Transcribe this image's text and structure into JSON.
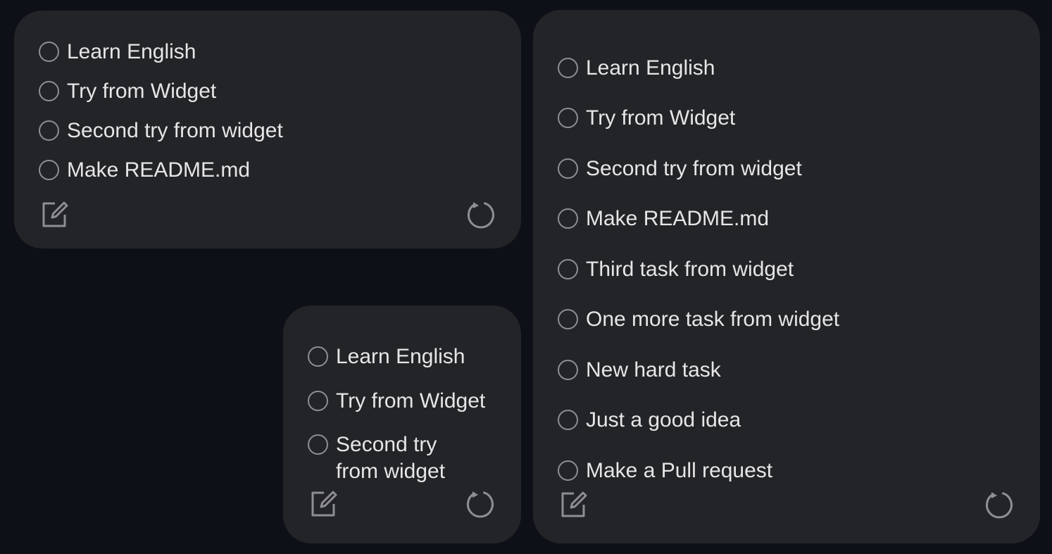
{
  "widgets": {
    "medium": {
      "tasks": [
        {
          "label": "Learn English"
        },
        {
          "label": "Try from Widget"
        },
        {
          "label": "Second try from widget"
        },
        {
          "label": "Make README.md"
        }
      ],
      "edit_icon": "edit-icon",
      "refresh_icon": "refresh-icon"
    },
    "small": {
      "tasks": [
        {
          "label": "Learn English"
        },
        {
          "label": "Try from Widget"
        },
        {
          "label": "Second try from widget"
        }
      ],
      "edit_icon": "edit-icon",
      "refresh_icon": "refresh-icon"
    },
    "large": {
      "tasks": [
        {
          "label": "Learn English"
        },
        {
          "label": "Try from Widget"
        },
        {
          "label": "Second try from widget"
        },
        {
          "label": "Make README.md"
        },
        {
          "label": "Third task from widget"
        },
        {
          "label": "One more task from widget"
        },
        {
          "label": "New hard task"
        },
        {
          "label": "Just a good idea"
        },
        {
          "label": "Make a Pull request"
        }
      ],
      "edit_icon": "edit-icon",
      "refresh_icon": "refresh-icon"
    }
  },
  "colors": {
    "background": "#0d1017",
    "widget": "#232427",
    "text": "#e6e6e8",
    "icon": "#8e8e93"
  }
}
